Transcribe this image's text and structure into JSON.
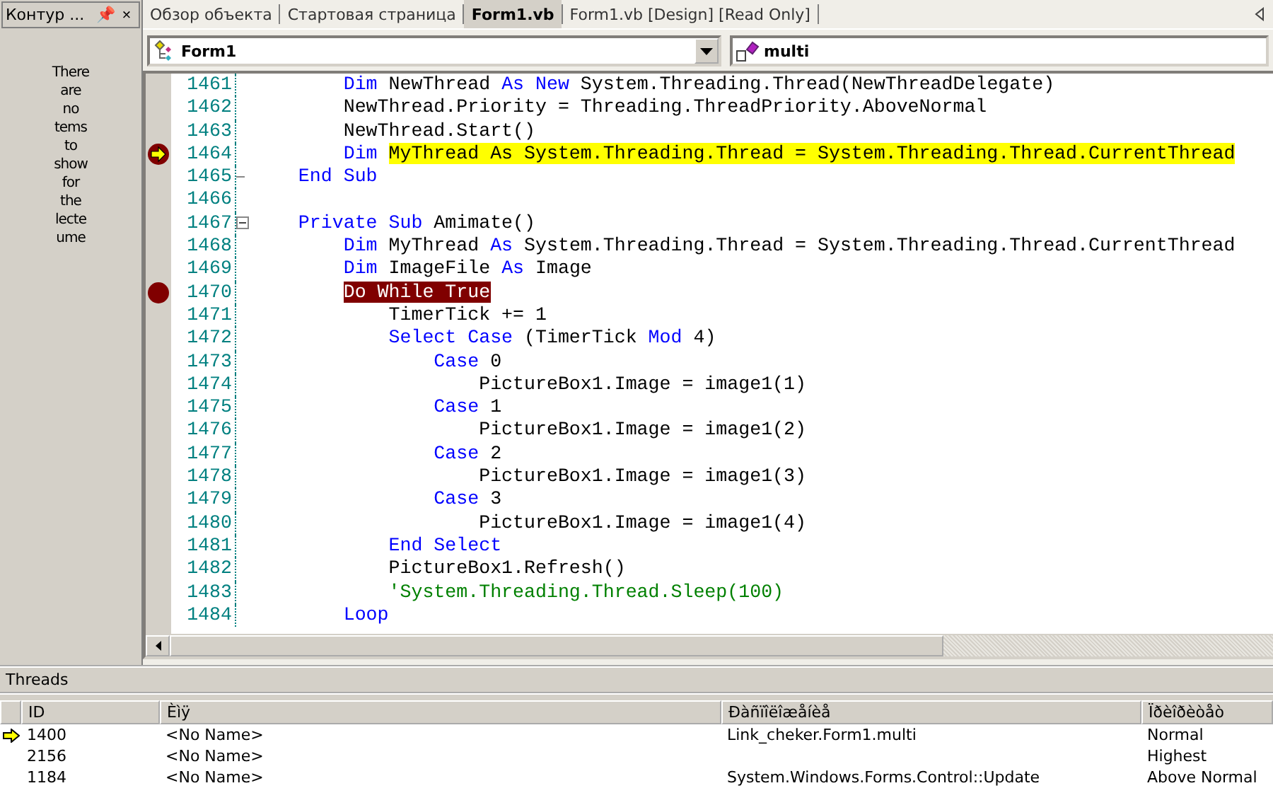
{
  "outline_panel": {
    "title": "Контур ...",
    "pin": "📌",
    "close": "×",
    "message_lines": [
      "There",
      "are",
      "no",
      "tems",
      "to",
      "show",
      "for",
      "the",
      "lecte",
      "ume"
    ]
  },
  "tabs": [
    {
      "label": "Обзор объекта",
      "selected": false
    },
    {
      "label": "Стартовая страница",
      "selected": false
    },
    {
      "label": "Form1.vb",
      "selected": true
    },
    {
      "label": "Form1.vb [Design] [Read Only]",
      "selected": false
    }
  ],
  "class_dropdown": {
    "value": "Form1"
  },
  "method_dropdown": {
    "value": "multi"
  },
  "code_lines": [
    {
      "num": "1461",
      "current": false,
      "breakpoint": false,
      "collapsible": false,
      "block_end": false,
      "tokens": [
        {
          "text": "        Dim",
          "kind": "kw"
        },
        {
          "text": " NewThread ",
          "kind": "plain"
        },
        {
          "text": "As New",
          "kind": "kw"
        },
        {
          "text": " System.Threading.Thread(NewThreadDelegate)",
          "kind": "plain"
        }
      ]
    },
    {
      "num": "1462",
      "current": false,
      "breakpoint": false,
      "collapsible": false,
      "block_end": false,
      "tokens": [
        {
          "text": "        NewThread.Priority = Threading.ThreadPriority.AboveNormal",
          "kind": "plain"
        }
      ]
    },
    {
      "num": "1463",
      "current": false,
      "breakpoint": false,
      "collapsible": false,
      "block_end": false,
      "tokens": [
        {
          "text": "        NewThread.Start()",
          "kind": "plain"
        }
      ]
    },
    {
      "num": "1464",
      "current": true,
      "breakpoint": true,
      "collapsible": false,
      "block_end": false,
      "tokens": [
        {
          "text": "        Dim ",
          "kind": "kw"
        },
        {
          "text": "MyThread As System.Threading.Thread = System.Threading.Thread.CurrentThread",
          "kind": "plain",
          "highlighted": true
        }
      ]
    },
    {
      "num": "1465",
      "current": false,
      "breakpoint": false,
      "collapsible": false,
      "block_end": true,
      "tokens": [
        {
          "text": "    End Sub",
          "kind": "kw"
        }
      ]
    },
    {
      "num": "1466",
      "current": false,
      "breakpoint": false,
      "collapsible": false,
      "block_end": false
    },
    {
      "num": "1467",
      "current": false,
      "breakpoint": false,
      "collapsible": true,
      "block_end": false,
      "tokens": [
        {
          "text": "    Private Sub",
          "kind": "kw"
        },
        {
          "text": " Amimate()",
          "kind": "plain"
        }
      ]
    },
    {
      "num": "1468",
      "current": false,
      "breakpoint": false,
      "collapsible": false,
      "block_end": false,
      "tokens": [
        {
          "text": "        Dim",
          "kind": "kw"
        },
        {
          "text": " MyThread ",
          "kind": "plain"
        },
        {
          "text": "As",
          "kind": "kw"
        },
        {
          "text": " System.Threading.Thread = System.Threading.Thread.CurrentThread",
          "kind": "plain"
        }
      ]
    },
    {
      "num": "1469",
      "current": false,
      "breakpoint": false,
      "collapsible": false,
      "block_end": false,
      "tokens": [
        {
          "text": "        Dim",
          "kind": "kw"
        },
        {
          "text": " ImageFile ",
          "kind": "plain"
        },
        {
          "text": "As",
          "kind": "kw"
        },
        {
          "text": " Image",
          "kind": "plain"
        }
      ]
    },
    {
      "num": "1470",
      "current": false,
      "breakpoint": true,
      "collapsible": false,
      "block_end": false,
      "tokens": [
        {
          "text": "        Do While True",
          "kind": "plain",
          "highlighted": true
        }
      ]
    },
    {
      "num": "1471",
      "current": false,
      "breakpoint": false,
      "collapsible": false,
      "block_end": false,
      "tokens": [
        {
          "text": "            TimerTick += 1",
          "kind": "plain"
        }
      ]
    },
    {
      "num": "1472",
      "current": false,
      "breakpoint": false,
      "collapsible": false,
      "block_end": false,
      "tokens": [
        {
          "text": "            Select Case",
          "kind": "kw"
        },
        {
          "text": " (TimerTick ",
          "kind": "plain"
        },
        {
          "text": "Mod",
          "kind": "kw"
        },
        {
          "text": " 4)",
          "kind": "plain"
        }
      ]
    },
    {
      "num": "1473",
      "current": false,
      "breakpoint": false,
      "collapsible": false,
      "block_end": false,
      "tokens": [
        {
          "text": "                Case",
          "kind": "kw"
        },
        {
          "text": " 0",
          "kind": "plain"
        }
      ]
    },
    {
      "num": "1474",
      "current": false,
      "breakpoint": false,
      "collapsible": false,
      "block_end": false,
      "tokens": [
        {
          "text": "                    PictureBox1.Image = image1(1)",
          "kind": "plain"
        }
      ]
    },
    {
      "num": "1475",
      "current": false,
      "breakpoint": false,
      "collapsible": false,
      "block_end": false,
      "tokens": [
        {
          "text": "                Case",
          "kind": "kw"
        },
        {
          "text": " 1",
          "kind": "plain"
        }
      ]
    },
    {
      "num": "1476",
      "current": false,
      "breakpoint": false,
      "collapsible": false,
      "block_end": false,
      "tokens": [
        {
          "text": "                    PictureBox1.Image = image1(2)",
          "kind": "plain"
        }
      ]
    },
    {
      "num": "1477",
      "current": false,
      "breakpoint": false,
      "collapsible": false,
      "block_end": false,
      "tokens": [
        {
          "text": "                Case",
          "kind": "kw"
        },
        {
          "text": " 2",
          "kind": "plain"
        }
      ]
    },
    {
      "num": "1478",
      "current": false,
      "breakpoint": false,
      "collapsible": false,
      "block_end": false,
      "tokens": [
        {
          "text": "                    PictureBox1.Image = image1(3)",
          "kind": "plain"
        }
      ]
    },
    {
      "num": "1479",
      "current": false,
      "breakpoint": false,
      "collapsible": false,
      "block_end": false,
      "tokens": [
        {
          "text": "                Case",
          "kind": "kw"
        },
        {
          "text": " 3",
          "kind": "plain"
        }
      ]
    },
    {
      "num": "1480",
      "current": false,
      "breakpoint": false,
      "collapsible": false,
      "block_end": false,
      "tokens": [
        {
          "text": "                    PictureBox1.Image = image1(4)",
          "kind": "plain"
        }
      ]
    },
    {
      "num": "1481",
      "current": false,
      "breakpoint": false,
      "collapsible": false,
      "block_end": false,
      "tokens": [
        {
          "text": "            End Select",
          "kind": "kw"
        }
      ]
    },
    {
      "num": "1482",
      "current": false,
      "breakpoint": false,
      "collapsible": false,
      "block_end": false,
      "tokens": [
        {
          "text": "            PictureBox1.Refresh()",
          "kind": "plain"
        }
      ]
    },
    {
      "num": "1483",
      "current": false,
      "breakpoint": false,
      "collapsible": false,
      "block_end": false,
      "tokens": [
        {
          "text": "            'System.Threading.Thread.Sleep(100)",
          "kind": "comment"
        }
      ]
    },
    {
      "num": "1484",
      "current": false,
      "breakpoint": false,
      "collapsible": false,
      "block_end": false,
      "tokens": [
        {
          "text": "        Loop",
          "kind": "kw"
        }
      ]
    }
  ],
  "threads_panel": {
    "title": "Threads",
    "columns": [
      "ID",
      "Èìÿ",
      "Ðàñïîëîæåíèå",
      "Ïðèîðèòåò"
    ],
    "rows": [
      {
        "current": true,
        "cells": [
          "1400",
          "<No Name>",
          "Link_cheker.Form1.multi",
          "Normal"
        ]
      },
      {
        "current": false,
        "cells": [
          "2156",
          "<No Name>",
          "",
          "Highest"
        ]
      },
      {
        "current": false,
        "cells": [
          "1184",
          "<No Name>",
          "System.Windows.Forms.Control::Update",
          "Above Normal"
        ]
      }
    ]
  }
}
